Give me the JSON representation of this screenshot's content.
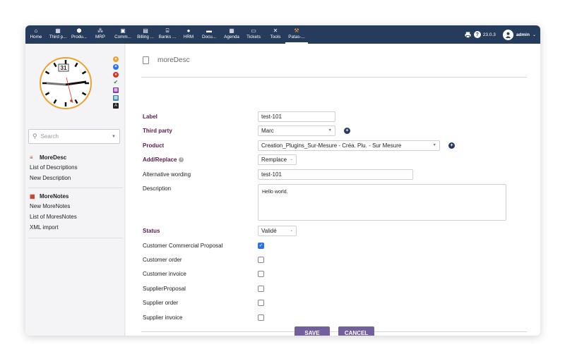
{
  "topbar": {
    "menu": [
      {
        "label": "Home",
        "icon": "home-icon",
        "glyph": "⌂"
      },
      {
        "label": "Third p...",
        "icon": "building-icon",
        "glyph": "▦"
      },
      {
        "label": "Produ...",
        "icon": "cube-icon",
        "glyph": "⬢"
      },
      {
        "label": "MRP",
        "icon": "cubes-icon",
        "glyph": "⁂"
      },
      {
        "label": "Comm...",
        "icon": "suitcase-icon",
        "glyph": "▣"
      },
      {
        "label": "Billing ...",
        "icon": "invoice-icon",
        "glyph": "▤"
      },
      {
        "label": "Banks ...",
        "icon": "bank-icon",
        "glyph": "⌸"
      },
      {
        "label": "HRM",
        "icon": "user-tie-icon",
        "glyph": "●"
      },
      {
        "label": "Docu...",
        "icon": "folder-icon",
        "glyph": "▬"
      },
      {
        "label": "Agenda",
        "icon": "calendar-icon",
        "glyph": "▦"
      },
      {
        "label": "Tickets",
        "icon": "ticket-icon",
        "glyph": "▭"
      },
      {
        "label": "Tools",
        "icon": "tools-icon",
        "glyph": "✕"
      },
      {
        "label": "Patas-...",
        "icon": "hammer-icon",
        "glyph": "⚒"
      }
    ],
    "version": "23.0.3",
    "user": "admin"
  },
  "sidebar": {
    "clock_date": "31",
    "search_placeholder": "Search",
    "sections": [
      {
        "title": "MoreDesc",
        "icon": "moredesc-module-icon",
        "links": [
          "List of Descriptions",
          "New Description"
        ]
      },
      {
        "title": "MoreNotes",
        "icon": "morenotes-module-icon",
        "links": [
          "New MoreNotes",
          "List of MoresNotes",
          "XML import"
        ]
      }
    ]
  },
  "main": {
    "page_title": "moreDesc",
    "fields": {
      "label": {
        "label": "Label",
        "value": "test-101"
      },
      "third_party": {
        "label": "Third party",
        "value": "Marc"
      },
      "product": {
        "label": "Product",
        "value": "Creation_Plugins_Sur-Mesure - Créa. Plu. - Sur Mesure"
      },
      "add_replace": {
        "label": "Add/Replace",
        "value": "Remplace"
      },
      "alt_wording": {
        "label": "Alternative wording",
        "value": "test-101"
      },
      "description": {
        "label": "Description",
        "value": "Hello world."
      },
      "status": {
        "label": "Status",
        "value": "Validé"
      }
    },
    "checkboxes": [
      {
        "label": "Customer Commercial Proposal",
        "checked": true
      },
      {
        "label": "Customer order",
        "checked": false
      },
      {
        "label": "Customer invoice",
        "checked": false
      },
      {
        "label": "SupplierProposal",
        "checked": false
      },
      {
        "label": "Supplier order",
        "checked": false
      },
      {
        "label": "Supplier invoice",
        "checked": false
      }
    ],
    "save_label": "SAVE",
    "cancel_label": "CANCEL"
  },
  "colors": {
    "topbar": "#263c5c",
    "button": "#735f9b",
    "required_label": "#5a1a4c",
    "checkbox_checked": "#2a6ff5",
    "clock_accent": "#f0a030"
  }
}
